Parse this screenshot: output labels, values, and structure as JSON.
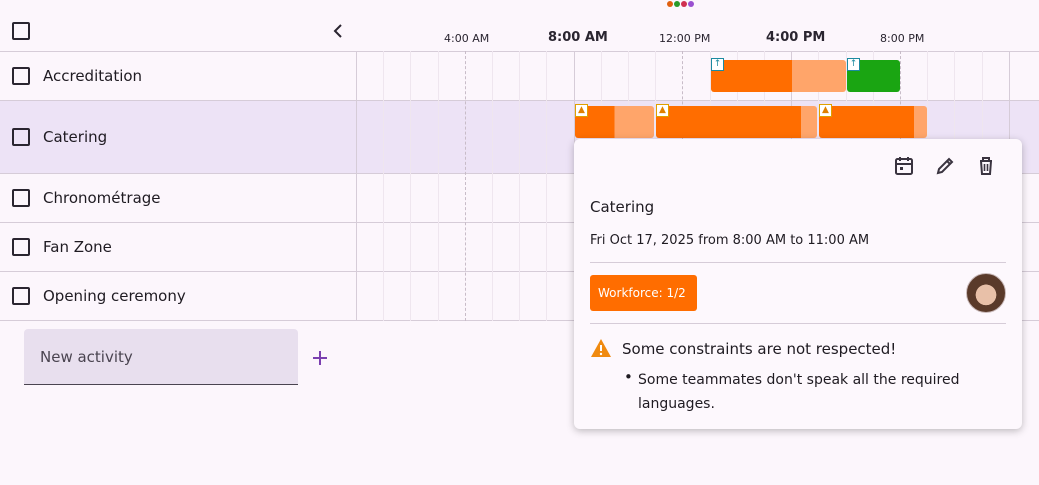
{
  "timeline": {
    "ticks": [
      {
        "label": "4:00 AM",
        "bold": false
      },
      {
        "label": "8:00 AM",
        "bold": true
      },
      {
        "label": "12:00 PM",
        "bold": false
      },
      {
        "label": "4:00 PM",
        "bold": true
      },
      {
        "label": "8:00 PM",
        "bold": false
      }
    ]
  },
  "rows": [
    {
      "label": "Accreditation"
    },
    {
      "label": "Catering"
    },
    {
      "label": "Chronométrage"
    },
    {
      "label": "Fan Zone"
    },
    {
      "label": "Opening ceremony"
    }
  ],
  "new_activity": {
    "placeholder": "New activity",
    "add_icon": "plus-icon"
  },
  "colors": {
    "orange": "#ff6d00",
    "orange_light": "#ffa56a",
    "green": "#1aa512",
    "selected_row": "#ede3f6",
    "accent": "#7b3fb0"
  },
  "popup": {
    "title": "Catering",
    "date": "Fri Oct 17, 2025 from 8:00 AM to 11:00 AM",
    "workforce": "Workforce: 1/2",
    "warning_title": "Some constraints are not respected!",
    "warning_items": [
      "Some teammates don't speak all the required languages."
    ],
    "icons": [
      "calendar-icon",
      "edit-icon",
      "delete-icon"
    ]
  }
}
